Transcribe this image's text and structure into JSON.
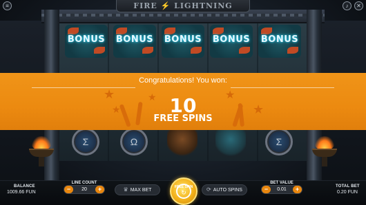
{
  "header": {
    "title_left": "FIRE",
    "title_bolt": "⚡",
    "title_right": "LIGHTNING",
    "menu_icon": "hamburger-icon",
    "close_icon": "close-icon",
    "sound_icon": "speaker-icon"
  },
  "reels": {
    "top_row": [
      {
        "symbol": "bonus",
        "label": "BONUS"
      },
      {
        "symbol": "bonus",
        "label": "BONUS"
      },
      {
        "symbol": "bonus",
        "label": "BONUS"
      },
      {
        "symbol": "bonus",
        "label": "BONUS"
      },
      {
        "symbol": "bonus",
        "label": "BONUS"
      }
    ],
    "bottom_row": [
      "sigma-shield",
      "omega-shield",
      "bronze-helmet",
      "blue-helmet",
      "sigma-shield"
    ]
  },
  "win_banner": {
    "congrats": "Congratulations! You won:",
    "amount": "10",
    "label": "FREE SPINS",
    "color": "#ec8a10"
  },
  "controls": {
    "balance_label": "BALANCE",
    "balance_value": "1009.66 FUN",
    "line_count_label": "LINE COUNT",
    "line_count_value": "20",
    "max_bet_label": "MAX BET",
    "spin_label": "FREE SPIN",
    "auto_spins_label": "AUTO SPINS",
    "bet_value_label": "BET VALUE",
    "bet_value_value": "0.01",
    "total_bet_label": "TOTAL BET",
    "total_bet_value": "0.20 FUN",
    "minus": "−",
    "plus": "+",
    "accent": "#e9870f"
  }
}
